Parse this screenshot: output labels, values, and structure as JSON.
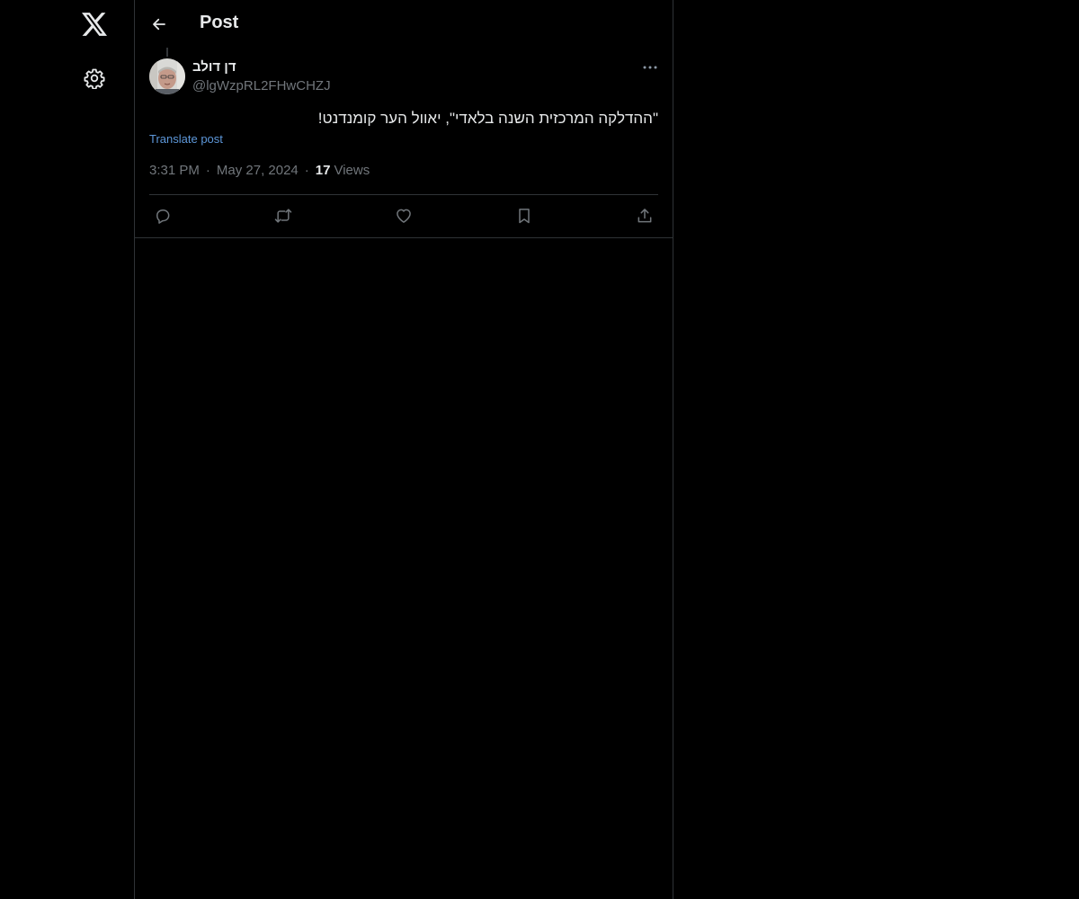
{
  "nav": {
    "logo_icon": "x-logo-icon",
    "settings_icon": "gear-icon"
  },
  "header": {
    "back_icon": "arrow-left-icon",
    "title": "Post"
  },
  "post": {
    "author": {
      "display_name": "דן דולב",
      "handle": "@lgWzpRL2FHwCHZJ"
    },
    "text": "\"ההדלקה המרכזית השנה בלאדי\", יאוול הער קומנדנט!",
    "translate_label": "Translate post",
    "time": "3:31 PM",
    "date": "May 27, 2024",
    "views_count": "17",
    "views_label": "Views"
  },
  "actions": [
    "reply-icon",
    "repost-icon",
    "like-icon",
    "bookmark-icon",
    "share-icon"
  ],
  "colors": {
    "background": "#000000",
    "border": "#2f3336",
    "text_primary": "#e7e9ea",
    "text_secondary": "#71767b",
    "link": "#5d97d9"
  }
}
